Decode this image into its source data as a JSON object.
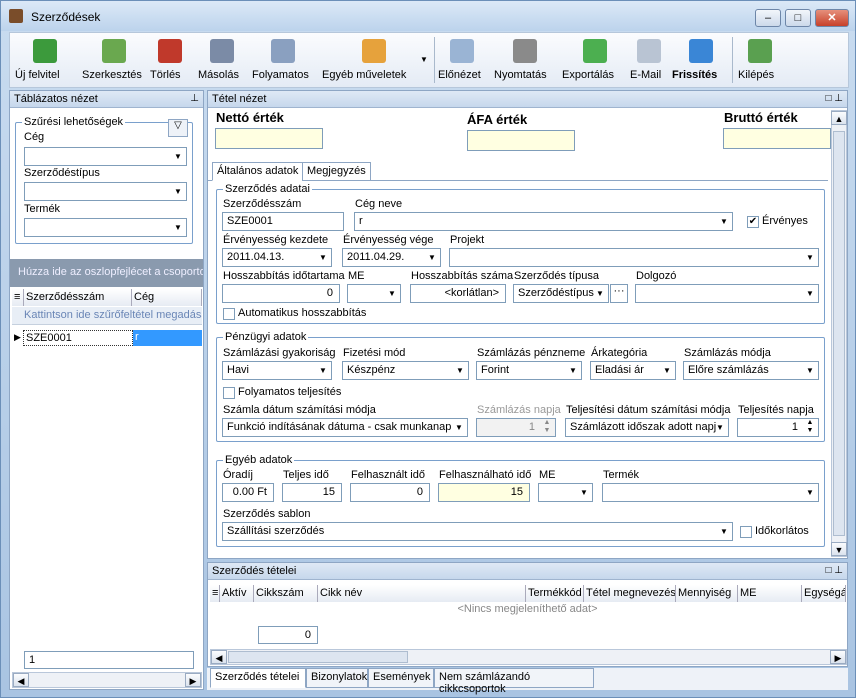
{
  "window": {
    "title": "Szerződések"
  },
  "toolbar": [
    {
      "label": "Új felvitel",
      "icon": "new-record-icon",
      "color": "#3c9a3c"
    },
    {
      "label": "Szerkesztés",
      "icon": "edit-icon",
      "color": "#6aa84f"
    },
    {
      "label": "Törlés",
      "icon": "delete-icon",
      "color": "#c0392b"
    },
    {
      "label": "Másolás",
      "icon": "copy-icon",
      "color": "#7b8ba6"
    },
    {
      "label": "Folyamatos",
      "icon": "continuous-icon",
      "color": "#8aa0c0"
    },
    {
      "label": "Egyéb műveletek",
      "icon": "other-actions-icon",
      "color": "#e6a23c"
    },
    {
      "label": "Előnézet",
      "icon": "preview-icon",
      "color": "#9ab4d4"
    },
    {
      "label": "Nyomtatás",
      "icon": "print-icon",
      "color": "#8a8a8a"
    },
    {
      "label": "Exportálás",
      "icon": "export-icon",
      "color": "#4caf50"
    },
    {
      "label": "E-Mail",
      "icon": "email-icon",
      "color": "#b9c4d3"
    },
    {
      "label": "Frissítés",
      "icon": "refresh-icon",
      "color": "#3a86d6"
    },
    {
      "label": "Kilépés",
      "icon": "exit-icon",
      "color": "#5aa050"
    }
  ],
  "left": {
    "title": "Táblázatos nézet",
    "filter_title": "Szűrési lehetőségek",
    "ceg_label": "Cég",
    "szt_label": "Szerződéstípus",
    "termek_label": "Termék",
    "group_hint": "Húzza ide az oszlopfejlécet a csoporto",
    "col1": "Szerződésszám",
    "col2": "Cég",
    "filter_hint": "Kattintson ide szűrőfeltétel megadásá",
    "row1_num": "SZE0001",
    "row1_ceg": "r",
    "page": "1"
  },
  "detail": {
    "title": "Tétel nézet",
    "netto": "Nettó érték",
    "afa": "ÁFA érték",
    "brutto": "Bruttó érték",
    "tab1": "Általános adatok",
    "tab2": "Megjegyzés",
    "g1": "Szerződés adatai",
    "szam_label": "Szerződésszám",
    "szam": "SZE0001",
    "cegnev_label": "Cég neve",
    "cegnev": "r",
    "ervenyes": "Érvényes",
    "kezd_label": "Érvényesség kezdete",
    "kezd": "2011.04.13.",
    "vege_label": "Érvényesség vége",
    "vege": "2011.04.29.",
    "projekt_label": "Projekt",
    "hossz_label": "Hosszabbítás időtartama",
    "hossz": "0",
    "me_label": "ME",
    "hszam_label": "Hosszabbítás száma",
    "hszam": "<korlátlan>",
    "tipus_label": "Szerződés típusa",
    "tipus": "Szerződéstípus",
    "dolg_label": "Dolgozó",
    "auto": "Automatikus hosszabbítás",
    "g2": "Pénzügyi adatok",
    "gyak_label": "Számlázási gyakoriság",
    "gyak": "Havi",
    "fiz_label": "Fizetési mód",
    "fiz": "Készpénz",
    "pnem_label": "Számlázás pénzneme",
    "pnem": "Forint",
    "ar_label": "Árkategória",
    "ar": "Eladási ár",
    "mod_label": "Számlázás módja",
    "mod": "Előre számlázás",
    "folyt": "Folyamatos teljesítés",
    "szdat_label": "Számla dátum számítási módja",
    "szdat": "Funkció indításának dátuma - csak munkanap",
    "sznap_label": "Számlázás napja",
    "sznap": "1",
    "tdat_label": "Teljesítési dátum számítási módja",
    "tdat": "Számlázott időszak adott napj",
    "tnap_label": "Teljesítés napja",
    "tnap": "1",
    "g3": "Egyéb adatok",
    "oradij_label": "Óradíj",
    "oradij": "0.00 Ft",
    "telj_label": "Teljes idő",
    "telj": "15",
    "felh_label": "Felhasznált idő",
    "felh": "0",
    "felhato_label": "Felhasználható idő",
    "felhato": "15",
    "me2_label": "ME",
    "termek_label": "Termék",
    "sablon_label": "Szerződés sablon",
    "sablon": "Szállítási szerződés",
    "idokorl": "Időkorlátos"
  },
  "items": {
    "title": "Szerződés tételei",
    "cols": [
      "Aktív",
      "Cikkszám",
      "Cikk név",
      "Termékkód",
      "Tétel megnevezés",
      "Mennyiség",
      "ME",
      "Egységár"
    ],
    "empty": "<Nincs megjeleníthető adat>",
    "sum": "0"
  },
  "bottom_tabs": [
    "Szerződés tételei",
    "Bizonylatok",
    "Események",
    "Nem számlázandó cikkcsoportok"
  ]
}
